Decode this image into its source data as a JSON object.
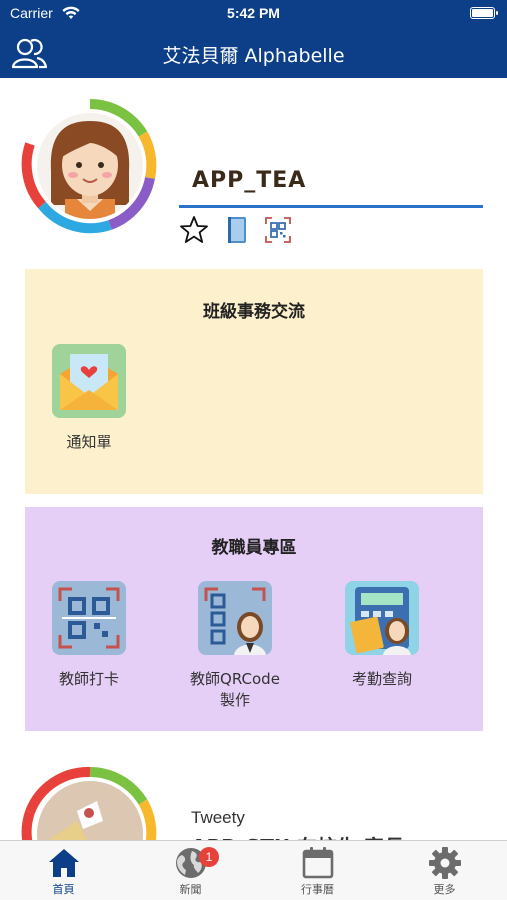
{
  "status_bar": {
    "carrier": "Carrier",
    "time": "5:42 PM"
  },
  "nav": {
    "title": "艾法貝爾 Alphabelle"
  },
  "profile": {
    "username": "APP_TEA"
  },
  "class_affairs": {
    "title": "班級事務交流",
    "items": [
      {
        "label": "通知單",
        "icon": "notice-envelope-icon"
      }
    ]
  },
  "staff_zone": {
    "title": "教職員專區",
    "items": [
      {
        "label": "教師打卡",
        "icon": "qr-checkin-icon"
      },
      {
        "label": "教師QRCode製作",
        "icon": "teacher-qrcode-icon"
      },
      {
        "label": "考勤查詢",
        "icon": "attendance-calculator-icon"
      }
    ]
  },
  "second_profile": {
    "name": "Tweety",
    "subtitle": "APP_STU 在校生 家長"
  },
  "tab_bar": {
    "tabs": [
      {
        "label": "首頁",
        "icon": "home-icon",
        "active": true
      },
      {
        "label": "新聞",
        "icon": "globe-icon",
        "badge": "1"
      },
      {
        "label": "行事曆",
        "icon": "calendar-icon"
      },
      {
        "label": "更多",
        "icon": "gear-icon"
      }
    ]
  },
  "colors": {
    "header": "#0c3f88",
    "class_panel": "#fdf1cd",
    "staff_panel": "#e6cff7",
    "accent_underline": "#2a73c9",
    "badge": "#e8413b"
  }
}
